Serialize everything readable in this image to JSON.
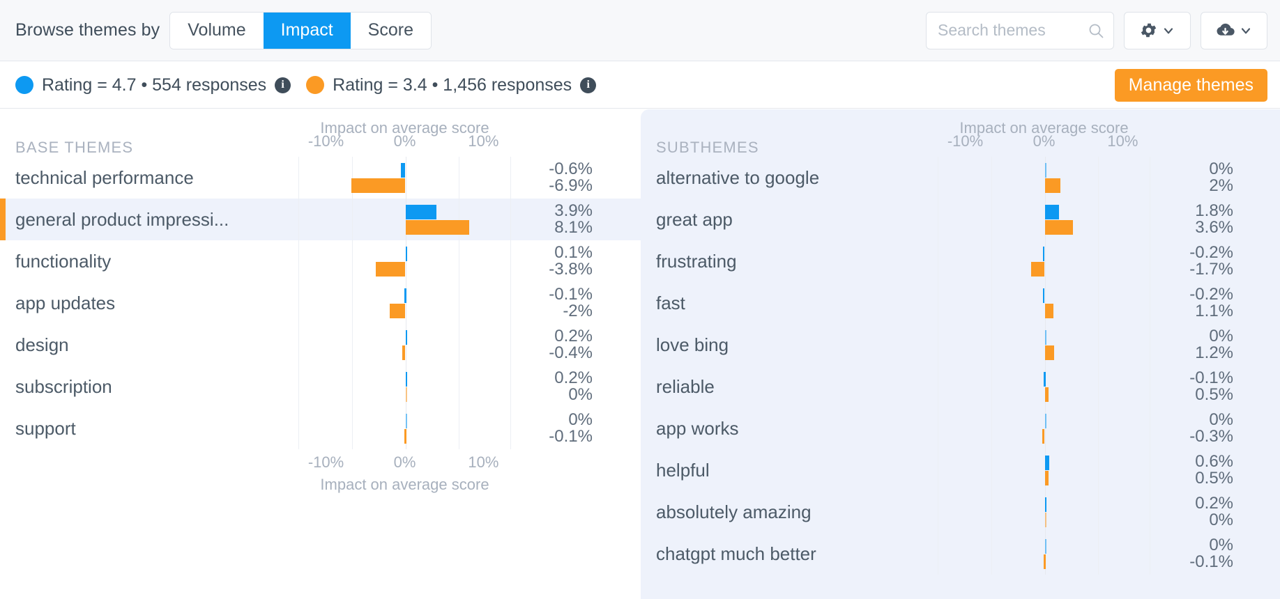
{
  "toolbar": {
    "browse_label": "Browse themes by",
    "segments": [
      {
        "label": "Volume",
        "active": false
      },
      {
        "label": "Impact",
        "active": true
      },
      {
        "label": "Score",
        "active": false
      }
    ],
    "search": {
      "placeholder": "Search themes",
      "value": ""
    },
    "settings_button": "gear-icon",
    "download_button": "cloud-download-icon"
  },
  "legend": {
    "series": [
      {
        "color": "#0d99f2",
        "label": "Rating = 4.7 • 554 responses",
        "rating": "4.7",
        "responses": "554"
      },
      {
        "color": "#fb9a24",
        "label": "Rating = 3.4 • 1,456 responses",
        "rating": "3.4",
        "responses": "1,456"
      }
    ],
    "info_tooltip": "i",
    "manage_button": "Manage themes"
  },
  "chart_data": [
    {
      "id": "base-themes",
      "type": "bar",
      "orientation": "horizontal",
      "title": "Impact on average score",
      "xlabel": "Impact on average score",
      "column_header": "BASE THEMES",
      "xlim": [
        -13.5,
        13.5
      ],
      "xticks": [
        "-10%",
        "0%",
        "10%"
      ],
      "xtick_values": [
        -10,
        0,
        10
      ],
      "grid": true,
      "legend_position": "top",
      "categories": [
        "technical performance",
        "general product impressi...",
        "functionality",
        "app updates",
        "design",
        "subscription",
        "support"
      ],
      "selected_index": 1,
      "series": [
        {
          "name": "Rating = 4.7 • 554 responses",
          "color": "#0d99f2",
          "values": [
            -0.6,
            3.9,
            0.1,
            -0.1,
            0.2,
            0.2,
            0
          ],
          "labels": [
            "-0.6%",
            "3.9%",
            "0.1%",
            "-0.1%",
            "0.2%",
            "0.2%",
            "0%"
          ]
        },
        {
          "name": "Rating = 3.4 • 1,456 responses",
          "color": "#fb9a24",
          "values": [
            -6.9,
            8.1,
            -3.8,
            -2,
            -0.4,
            0,
            -0.1
          ],
          "labels": [
            "-6.9%",
            "8.1%",
            "-3.8%",
            "-2%",
            "-0.4%",
            "0%",
            "-0.1%"
          ]
        }
      ]
    },
    {
      "id": "subthemes",
      "type": "bar",
      "orientation": "horizontal",
      "title": "Impact on average score",
      "xlabel": "Impact on average score",
      "column_header": "SUBTHEMES",
      "xlim": [
        -13.5,
        13.5
      ],
      "xticks": [
        "-10%",
        "0%",
        "10%"
      ],
      "xtick_values": [
        -10,
        0,
        10
      ],
      "grid": true,
      "legend_position": "top",
      "categories": [
        "alternative to google",
        "great app",
        "frustrating",
        "fast",
        "love bing",
        "reliable",
        "app works",
        "helpful",
        "absolutely amazing",
        "chatgpt much better"
      ],
      "selected_index": -1,
      "series": [
        {
          "name": "Rating = 4.7 • 554 responses",
          "color": "#0d99f2",
          "values": [
            0,
            1.8,
            -0.2,
            -0.2,
            0,
            -0.1,
            0,
            0.6,
            0.2,
            0
          ],
          "labels": [
            "0%",
            "1.8%",
            "-0.2%",
            "-0.2%",
            "0%",
            "-0.1%",
            "0%",
            "0.6%",
            "0.2%",
            "0%"
          ]
        },
        {
          "name": "Rating = 3.4 • 1,456 responses",
          "color": "#fb9a24",
          "values": [
            2,
            3.6,
            -1.7,
            1.1,
            1.2,
            0.5,
            -0.3,
            0.5,
            0,
            -0.1
          ],
          "labels": [
            "2%",
            "3.6%",
            "-1.7%",
            "1.1%",
            "1.2%",
            "0.5%",
            "-0.3%",
            "0.5%",
            "0%",
            "-0.1%"
          ]
        }
      ]
    }
  ]
}
